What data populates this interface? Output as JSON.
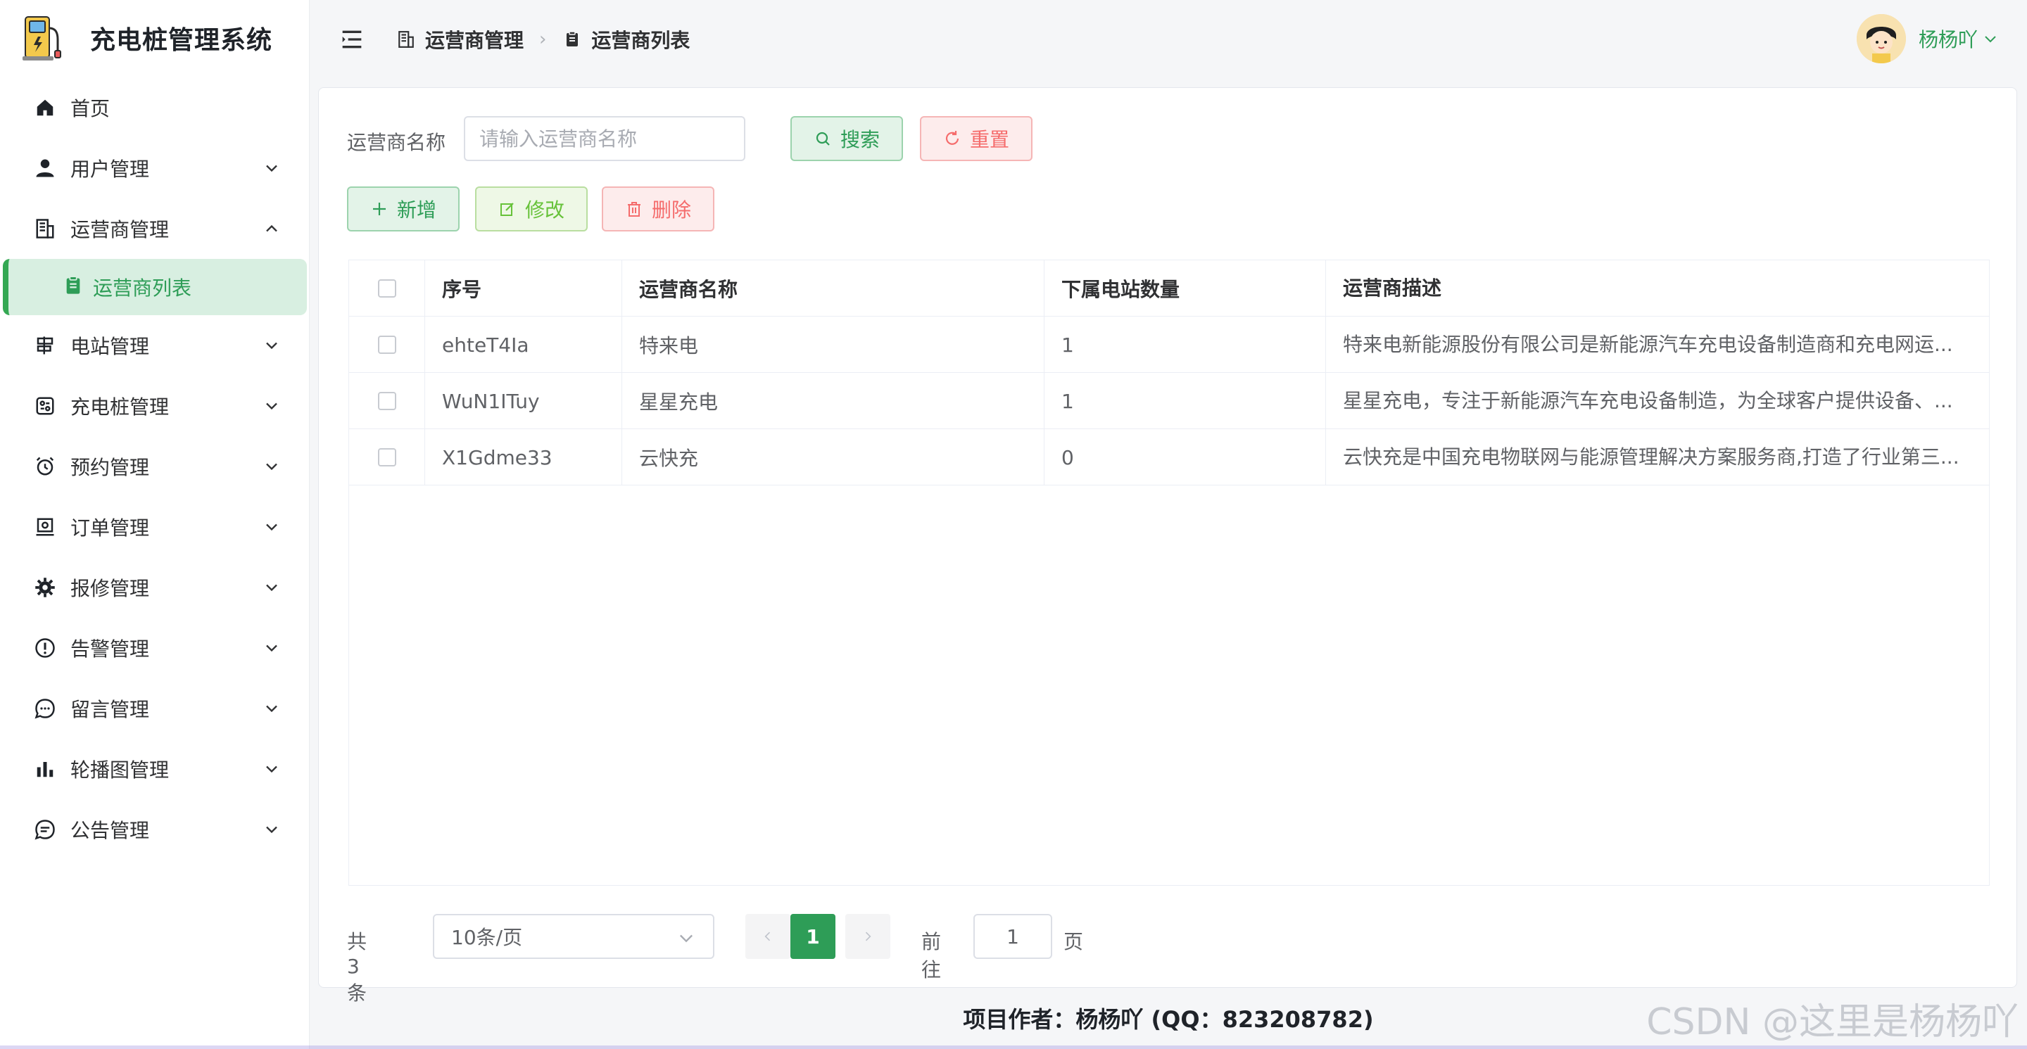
{
  "app": {
    "title": "充电桩管理系统"
  },
  "sidebar": {
    "items": [
      {
        "label": "首页",
        "icon": "home-icon"
      },
      {
        "label": "用户管理",
        "icon": "user-icon"
      },
      {
        "label": "运营商管理",
        "icon": "building-icon",
        "expanded": true
      },
      {
        "label": "电站管理",
        "icon": "signpost-icon"
      },
      {
        "label": "充电桩管理",
        "icon": "charger-icon"
      },
      {
        "label": "预约管理",
        "icon": "alarm-clock-icon"
      },
      {
        "label": "订单管理",
        "icon": "ticket-icon"
      },
      {
        "label": "报修管理",
        "icon": "gear-icon"
      },
      {
        "label": "告警管理",
        "icon": "warning-circle-icon"
      },
      {
        "label": "留言管理",
        "icon": "chat-dots-icon"
      },
      {
        "label": "轮播图管理",
        "icon": "bar-chart-icon"
      },
      {
        "label": "公告管理",
        "icon": "chat-lines-icon"
      }
    ],
    "submenu": {
      "label": "运营商列表",
      "icon": "clipboard-icon",
      "active": true
    }
  },
  "header": {
    "breadcrumb": [
      {
        "label": "运营商管理",
        "icon": "building-icon"
      },
      {
        "label": "运营商列表",
        "icon": "clipboard-icon"
      }
    ],
    "user_name": "杨杨吖"
  },
  "search": {
    "label": "运营商名称",
    "placeholder": "请输入运营商名称",
    "value": "",
    "search_button": "搜索",
    "reset_button": "重置"
  },
  "toolbar": {
    "add_label": "新增",
    "edit_label": "修改",
    "delete_label": "删除"
  },
  "table": {
    "columns": [
      "序号",
      "运营商名称",
      "下属电站数量",
      "运营商描述"
    ],
    "rows": [
      {
        "id": "ehteT4Ia",
        "name": "特来电",
        "stations": "1",
        "desc": "特来电新能源股份有限公司是新能源汽车充电设备制造商和充电网运..."
      },
      {
        "id": "WuN1ITuy",
        "name": "星星充电",
        "stations": "1",
        "desc": "星星充电，专注于新能源汽车充电设备制造，为全球客户提供设备、..."
      },
      {
        "id": "X1Gdme33",
        "name": "云快充",
        "stations": "0",
        "desc": "云快充是中国充电物联网与能源管理解决方案服务商,打造了行业第三..."
      }
    ]
  },
  "pagination": {
    "total_text": "共 3 条",
    "page_size": "10条/页",
    "current_page": "1",
    "goto_label": "前往",
    "goto_value": "1",
    "goto_unit": "页"
  },
  "footer": {
    "author_text": "项目作者：杨杨吖 (QQ：823208782)",
    "watermark": "CSDN @这里是杨杨吖"
  },
  "colors": {
    "accent": "#2e9d57",
    "danger": "#f56c6c",
    "success": "#67c23a"
  }
}
